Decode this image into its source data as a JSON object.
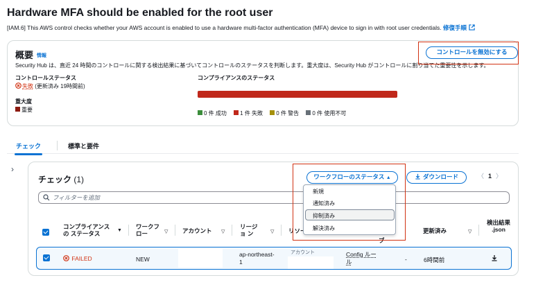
{
  "page": {
    "title": "Hardware MFA should be enabled for the root user",
    "description": "[IAM.6] This AWS control checks whether your AWS account is enabled to use a hardware multi-factor authentication (MFA) device to sign in with root user credentials.",
    "remediation_link": "修復手順"
  },
  "overview": {
    "heading": "概要",
    "info_link": "情報",
    "description": "Security Hub は、直近 24 時間のコントロールに関する検出結果に基づいてコントロールのステータスを判断します。重大度は、Security Hub がコントロールに割り当てた重要性を示します。",
    "disable_button": "コントロールを無効にする",
    "control_status_label": "コントロールステータス",
    "control_status_value": "失敗",
    "control_status_updated": "(更新済み 19時間前)",
    "severity_label": "重大度",
    "severity_value": "重要",
    "compliance_label": "コンプライアンスのステータス",
    "legend": {
      "passed": "0 件 成功",
      "failed": "1 件 失敗",
      "warning": "0 件 警告",
      "unavailable": "0 件 使用不可"
    },
    "compliance_counts": {
      "passed": 0,
      "failed": 1,
      "warning": 0,
      "unavailable": 0
    }
  },
  "tabs": {
    "checks": "チェック",
    "standards": "標準と要件"
  },
  "checks": {
    "title": "チェック",
    "count": "(1)",
    "workflow_button": "ワークフローのステータス",
    "download_button": "ダウンロード",
    "page_number": "1",
    "filter_placeholder": "フィルターを追加",
    "columns": {
      "compliance": "コンプライアンスの ステータス",
      "workflow": "ワークフ ロー",
      "account": "アカウント",
      "region": "リージョ ン",
      "resource": "リソー",
      "name": "メ ーブ",
      "updated": "更新済み",
      "finding_json": "検出結果 .json"
    },
    "row": {
      "compliance": "FAILED",
      "workflow": "NEW",
      "region": "ap-northeast-1",
      "account_label": "アカウント",
      "resource": "Config ルール",
      "dash": "-",
      "updated": "6時間前"
    }
  },
  "workflow_menu": {
    "items": [
      "新規",
      "通知済み",
      "抑制済み",
      "解決済み"
    ],
    "highlighted_index": 2
  },
  "colors": {
    "accent": "#0972d3",
    "failed": "#d13212",
    "critical": "#8c1a0f",
    "passed": "#3b8d3b",
    "warning": "#a5900a",
    "unavailable": "#687078",
    "bar": "#c0281b"
  }
}
